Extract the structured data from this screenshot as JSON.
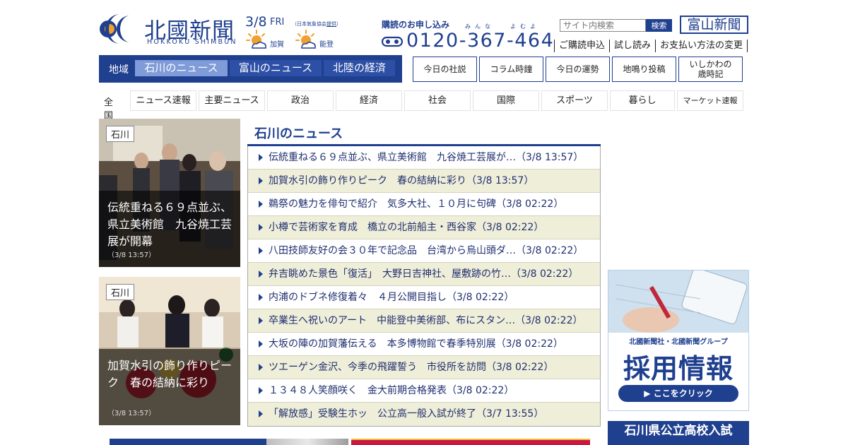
{
  "header": {
    "logo_jp": "北國新聞",
    "logo_en": "HOKKOKU SHIMBUN",
    "date": "3/8",
    "dow": "FRI",
    "weather_assoc": "（日本気象協会",
    "weather_assoc_link": "提供",
    "weather_assoc_close": "）",
    "weather": [
      {
        "label": "加賀",
        "icon": "sun-cloud-icon"
      },
      {
        "label": "能登",
        "icon": "sun-cloud-icon"
      }
    ],
    "subscribe_title": "購読のお申し込み",
    "ruby_1": "みんな",
    "ruby_2": "よむよ",
    "phone": "0120-367-464",
    "search_placeholder": "サイト内検索",
    "search_button": "検索",
    "toyama_logo": "富山新聞",
    "top_links": [
      "ご購読申込",
      "試し読み",
      "お支払い方法の変更"
    ]
  },
  "region_nav": {
    "label": "地域",
    "tabs": [
      {
        "label": "石川のニュース",
        "active": true
      },
      {
        "label": "富山のニュース",
        "active": false
      },
      {
        "label": "北陸の経済",
        "active": false
      }
    ]
  },
  "quick_buttons": [
    "今日の社説",
    "コラム時鐘",
    "今日の運勢",
    "地鳴り投稿",
    "いしかわの\n歳時記"
  ],
  "categories": {
    "all": "全国",
    "items": [
      "ニュース速報",
      "主要ニュース",
      "政治",
      "経済",
      "社会",
      "国際",
      "スポーツ",
      "暮らし",
      "マーケット速報"
    ]
  },
  "feature_cards": [
    {
      "tag": "石川",
      "title": "伝統重ねる６９点並ぶ、県立美術館　九谷焼工芸展が開幕",
      "time": "（3/8 13:57）"
    },
    {
      "tag": "石川",
      "title": "加賀水引の飾り作りピーク　春の結納に彩り",
      "time": "（3/8 13:57）"
    }
  ],
  "news_section": {
    "title": "石川のニュース",
    "items": [
      "伝統重ねる６９点並ぶ、県立美術館　九谷焼工芸展が…（3/8 13:57）",
      "加賀水引の飾り作りピーク　春の結納に彩り（3/8 13:57）",
      "鵜祭の魅力を俳句で紹介　気多大社、１０月に句碑（3/8 02:22）",
      "小樽で芸術家を育成　橋立の北前船主・西谷家（3/8 02:22）",
      "八田技師友好の会３０年で記念品　台湾から烏山頭ダ…（3/8 02:22）",
      "弁吉眺めた景色「復活」　大野日吉神社、屋敷跡の竹…（3/8 02:22）",
      "内浦のドブネ修復着々　４月公開目指し（3/8 02:22）",
      "卒業生へ祝いのアート　中能登中美術部、布にスタン…（3/8 02:22）",
      "大坂の陣の加賀藩伝える　本多博物館で春季特別展（3/8 02:22）",
      "ツエーゲン金沢、今季の飛躍誓う　市役所を訪問（3/8 02:22）",
      "１３４８人笑顔咲く　金大前期合格発表（3/8 02:22）",
      "「解放感」受験生ホッ　公立高一般入試が終了（3/7 13:55）"
    ]
  },
  "right_column": {
    "recruit_sub": "北國新聞社・北國新聞グループ",
    "recruit_big": "採用情報",
    "recruit_cta": "▶ ここをクリック",
    "exam_banner": "石川県公立高校入試"
  },
  "colors": {
    "brand": "#1f3f8f",
    "accent_orange": "#f0a030",
    "alt_row": "#efeed9"
  }
}
